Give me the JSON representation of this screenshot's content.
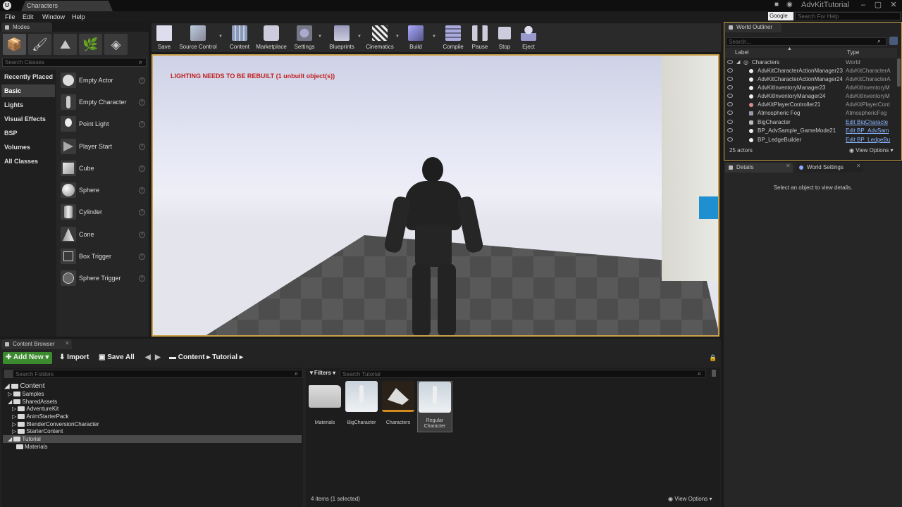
{
  "app": {
    "title": "AdvKitTutorial",
    "doc_tab": "Characters",
    "logo": "U"
  },
  "menu": [
    "File",
    "Edit",
    "Window",
    "Help"
  ],
  "help_search": {
    "provider": "Google",
    "placeholder": "Search For Help"
  },
  "modes": {
    "tab": "Modes",
    "search_placeholder": "Search Classes",
    "categories": [
      "Recently Placed",
      "Basic",
      "Lights",
      "Visual Effects",
      "BSP",
      "Volumes",
      "All Classes"
    ],
    "items": [
      "Empty Actor",
      "Empty Character",
      "Point Light",
      "Player Start",
      "Cube",
      "Sphere",
      "Cylinder",
      "Cone",
      "Box Trigger",
      "Sphere Trigger"
    ],
    "help_glyph": "?"
  },
  "toolbar": [
    "Save",
    "Source Control",
    "Content",
    "Marketplace",
    "Settings",
    "Blueprints",
    "Cinematics",
    "Build",
    "Compile",
    "Pause",
    "Stop",
    "Eject"
  ],
  "viewport": {
    "warning": "LIGHTING NEEDS TO BE REBUILT (1 unbuilt object(s))"
  },
  "outliner": {
    "tab": "World Outliner",
    "search_placeholder": "Search...",
    "col_label": "Label",
    "col_type": "Type",
    "rows": [
      {
        "label": "Characters",
        "type": "World"
      },
      {
        "label": "AdvKitCharacterActionManager23",
        "type": "AdvKitCharacterA"
      },
      {
        "label": "AdvKitCharacterActionManager24",
        "type": "AdvKitCharacterA"
      },
      {
        "label": "AdvKitInventoryManager23",
        "type": "AdvKitInventoryM"
      },
      {
        "label": "AdvKitInventoryManager24",
        "type": "AdvKitInventoryM"
      },
      {
        "label": "AdvKitPlayerController21",
        "type": "AdvKitPlayerCont"
      },
      {
        "label": "Atmospheric Fog",
        "type": "AtmosphericFog"
      },
      {
        "label": "BigCharacter",
        "type": "Edit BigCharacte"
      },
      {
        "label": "BP_AdvSample_GameMode21",
        "type": "Edit BP_AdvSam"
      },
      {
        "label": "BP_LedgeBuilder",
        "type": "Edit BP_LedgeBu"
      }
    ],
    "actor_count": "25 actors",
    "view_options": "View Options"
  },
  "details": {
    "tab": "Details",
    "tab2": "World Settings",
    "empty_msg": "Select an object to view details."
  },
  "content_browser": {
    "tab": "Content Browser",
    "add_new": "Add New",
    "import": "Import",
    "save_all": "Save All",
    "breadcrumb": [
      "Content",
      "Tutorial"
    ],
    "folder_search": "Search Folders",
    "asset_search": "Search Tutorial",
    "filters": "Filters",
    "tree": [
      "Content",
      "Samples",
      "SharedAssets",
      "AdventureKit",
      "AnimStarterPack",
      "BlenderConversionCharacter",
      "StarterContent",
      "Tutorial",
      "Materials"
    ],
    "assets": [
      "Materials",
      "BigCharacter",
      "Characters",
      "Regular Character"
    ],
    "status": "4 items (1 selected)",
    "view_options": "View Options"
  }
}
